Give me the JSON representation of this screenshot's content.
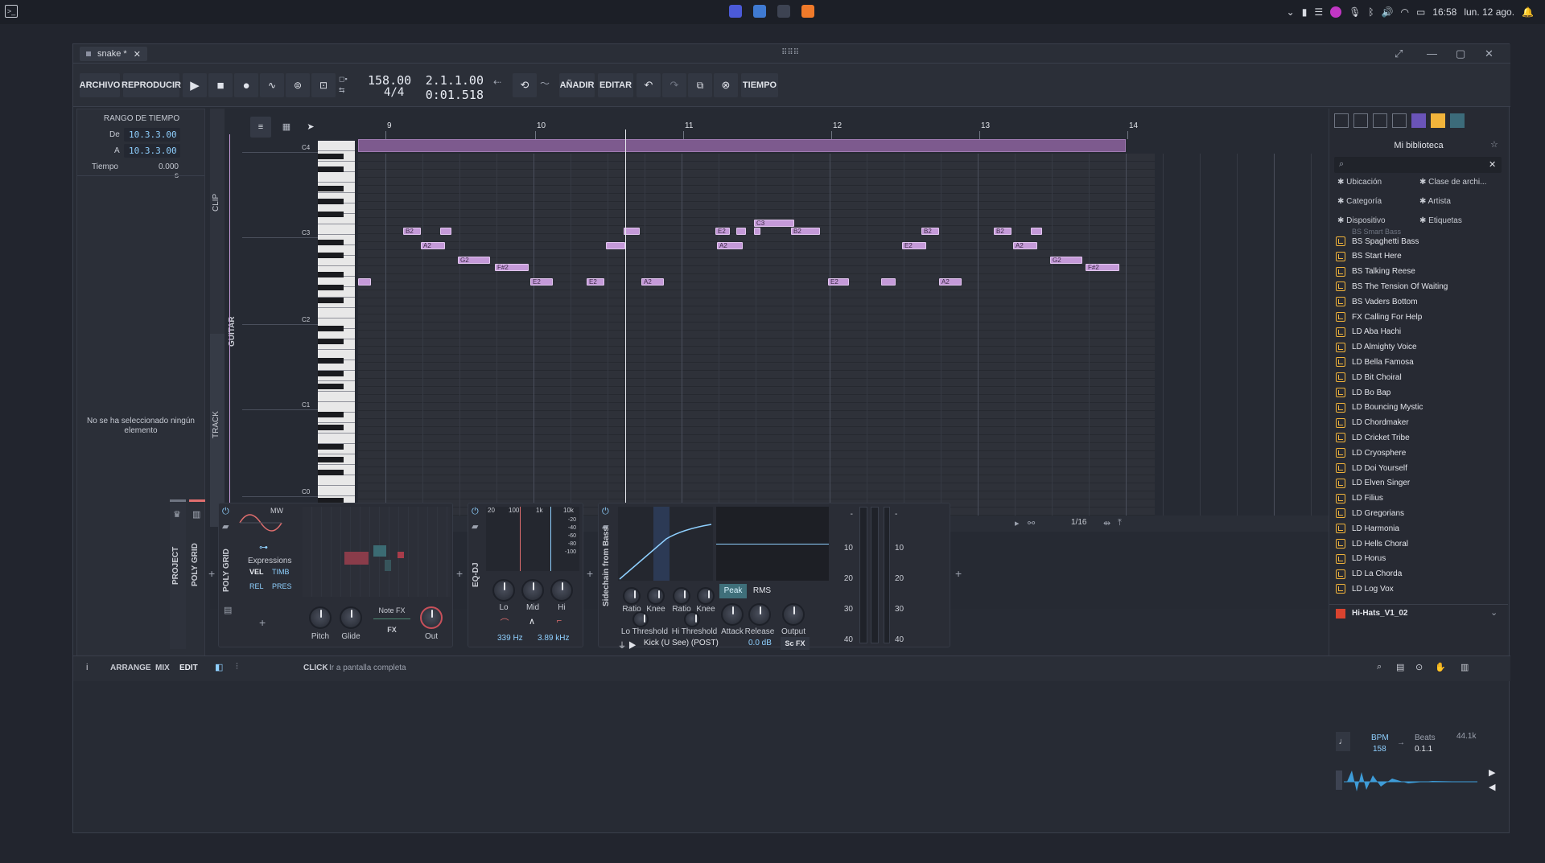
{
  "system": {
    "time": "16:58",
    "date": "lun. 12 ago."
  },
  "window": {
    "tab_title": "snake *"
  },
  "toolbar": {
    "archivo": "ARCHIVO",
    "reproducir": "REPRODUCIR",
    "tempo": "158.00",
    "signature": "4/4",
    "position_bars": "2.1.1.00",
    "position_time": "0:01.518",
    "anadir": "AÑADIR",
    "editar": "EDITAR",
    "tiempo": "TIEMPO"
  },
  "left_panel": {
    "title": "RANGO DE TIEMPO",
    "de_label": "De",
    "de_value": "10.3.3.00",
    "a_label": "A",
    "a_value": "10.3.3.00",
    "tiempo_label": "Tiempo",
    "tiempo_value": "0.000 s",
    "empty_text": "No se ha seleccionado ningún elemento"
  },
  "editor": {
    "side_labels": {
      "clip": "CLIP",
      "guitar": "GUITAR",
      "track": "TRACK"
    },
    "ruler": [
      "9",
      "10",
      "11",
      "12",
      "13",
      "14"
    ],
    "octaves": [
      "C4",
      "C3",
      "C2",
      "C1",
      "C0"
    ],
    "grid_value": "1/16",
    "notes": [
      {
        "label": "B2"
      },
      {
        "label": ""
      },
      {
        "label": "A2"
      },
      {
        "label": "G2"
      },
      {
        "label": "F#2"
      },
      {
        "label": "E2"
      },
      {
        "label": "E2"
      },
      {
        "label": "A2"
      },
      {
        "label": ""
      },
      {
        "label": "E2"
      },
      {
        "label": ""
      },
      {
        "label": "A2"
      },
      {
        "label": ""
      },
      {
        "label": "C3"
      },
      {
        "label": ""
      },
      {
        "label": "B2"
      },
      {
        "label": "E2"
      },
      {
        "label": ""
      },
      {
        "label": "A2"
      },
      {
        "label": "B2"
      },
      {
        "label": "E2"
      },
      {
        "label": "B2"
      },
      {
        "label": ""
      },
      {
        "label": "A2"
      },
      {
        "label": "G2"
      },
      {
        "label": "F#2"
      },
      {
        "label": ""
      }
    ]
  },
  "mixer": {
    "side_project": "PROJECT",
    "side_polygrid": "POLY GRID",
    "polygrid": {
      "title": "POLY GRID",
      "mw": "MW",
      "expressions": "Expressions",
      "vel": "VEL",
      "timb": "TIMB",
      "rel": "REL",
      "pres": "PRES",
      "pitch": "Pitch",
      "glide": "Glide",
      "note_fx": "Note FX",
      "fx": "FX",
      "out": "Out"
    },
    "eqdj": {
      "title": "EQ-DJ",
      "scale_top": [
        "20",
        "100",
        "1k",
        "10k"
      ],
      "db_scale": [
        "-20",
        "-40",
        "-60",
        "-80",
        "-100"
      ],
      "lo": "Lo",
      "mid": "Mid",
      "hi": "Hi",
      "lo_freq": "339 Hz",
      "hi_freq": "3.89 kHz"
    },
    "sidechain": {
      "title": "Sidechain from Bass",
      "ratio1": "Ratio",
      "knee1": "Knee",
      "ratio2": "Ratio",
      "knee2": "Knee",
      "lo_threshold": "Lo Threshold",
      "hi_threshold": "Hi Threshold",
      "peak": "Peak",
      "rms": "RMS",
      "attack": "Attack",
      "release": "Release",
      "output": "Output",
      "source": "Kick (U See) (POST)",
      "gain": "0.0 dB",
      "scfx": "Sc FX",
      "meter_scale_left": [
        "-",
        "10",
        "20",
        "30",
        "40"
      ],
      "meter_scale_right": [
        "-",
        "10",
        "20",
        "30",
        "40"
      ]
    }
  },
  "browser": {
    "title": "Mi biblioteca",
    "filters": [
      "Ubicación",
      "Clase de archi...",
      "Categoría",
      "Artista",
      "Dispositivo",
      "Etiquetas"
    ],
    "partial_item": "BS Smart Bass",
    "items": [
      "BS Spaghetti Bass",
      "BS Start Here",
      "BS Talking Reese",
      "BS The Tension Of Waiting",
      "BS Vaders Bottom",
      "FX Calling For Help",
      "LD Aba Hachi",
      "LD Almighty Voice",
      "LD Bella Famosa",
      "LD Bit Choiral",
      "LD Bo Bap",
      "LD Bouncing Mystic",
      "LD Chordmaker",
      "LD Cricket Tribe",
      "LD Cryosphere",
      "LD Doi Yourself",
      "LD Elven Singer",
      "LD Filius",
      "LD Gregorians",
      "LD Harmonia",
      "LD Hells Choral",
      "LD Horus",
      "LD La Chorda",
      "LD Log Vox"
    ],
    "preview_file": "Hi-Hats_V1_02",
    "bpm_label": "BPM",
    "bpm_value": "158",
    "beats_label": "Beats",
    "beats_value": "0.1.1",
    "sample_rate": "44.1k"
  },
  "bottom": {
    "arrange": "ARRANGE",
    "mix": "MIX",
    "edit": "EDIT",
    "click": "CLICK",
    "hint": "Ir a pantalla completa"
  }
}
